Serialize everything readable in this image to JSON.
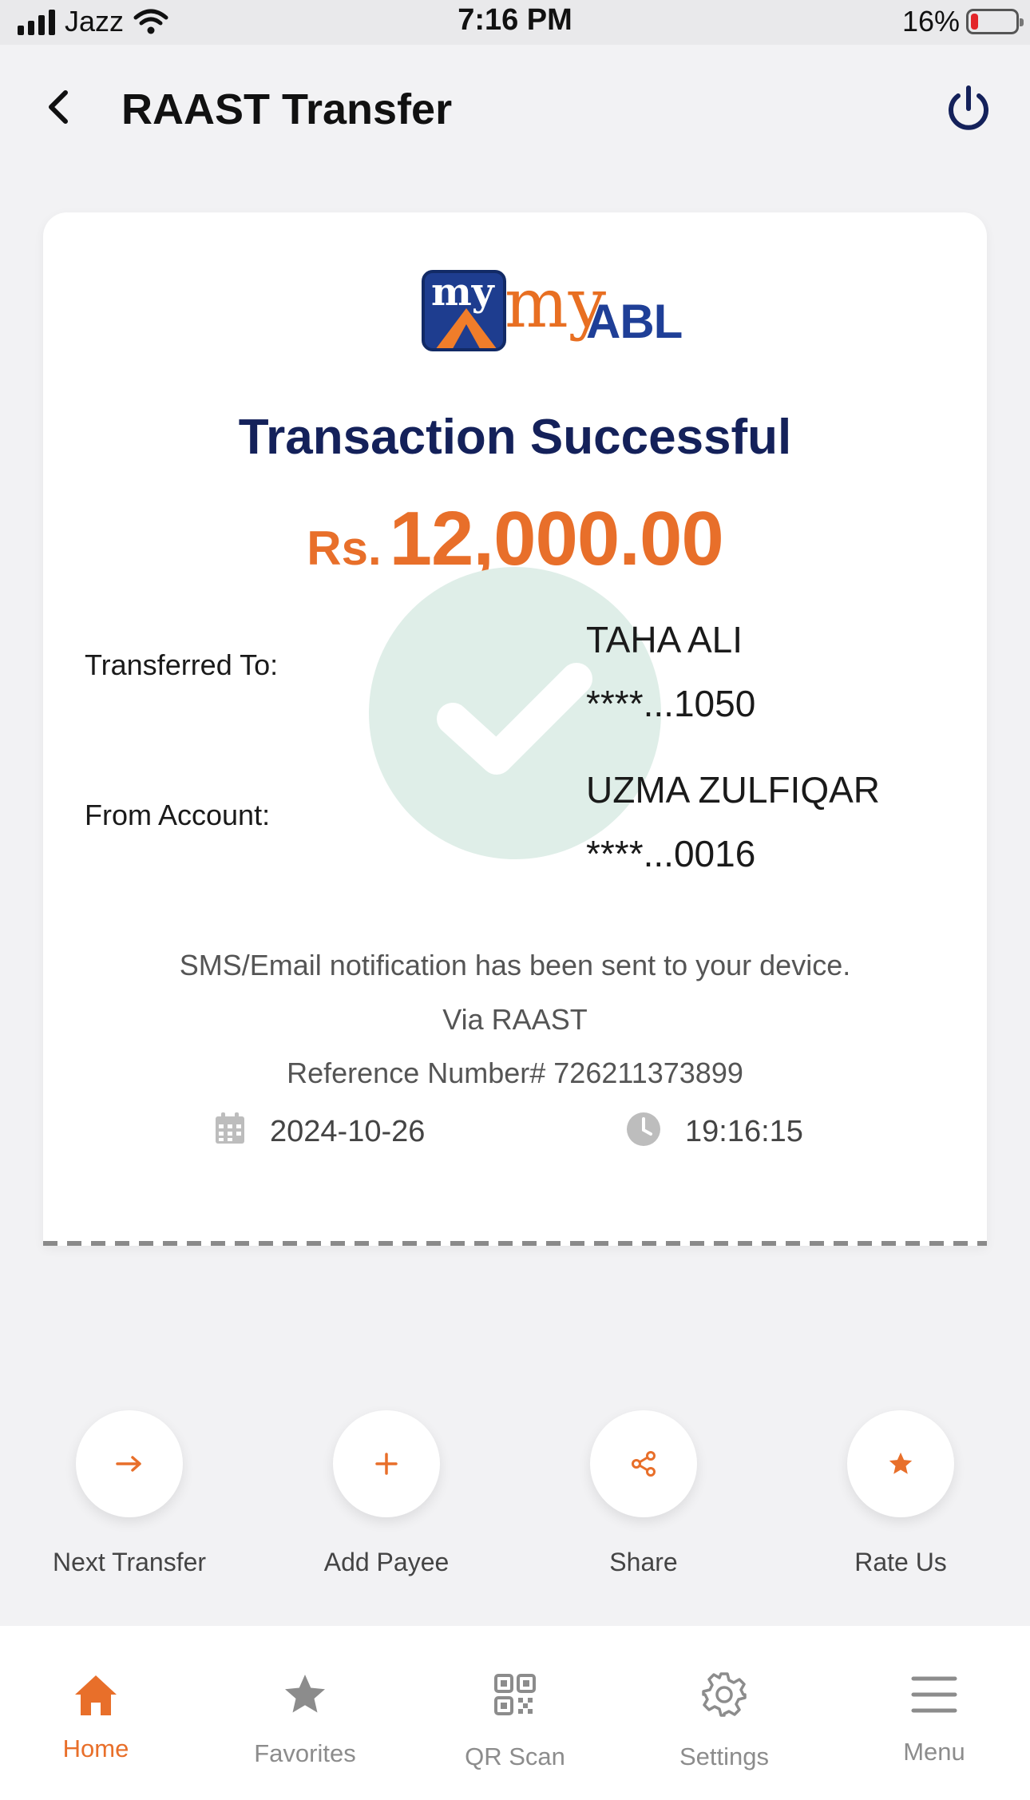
{
  "status_bar": {
    "carrier": "Jazz",
    "time": "7:16 PM",
    "battery": "16%",
    "battery_level": 0.16
  },
  "header": {
    "title": "RAAST Transfer",
    "back_icon": "chevron-left-icon",
    "power_icon": "power-icon"
  },
  "receipt": {
    "logo_my": "my",
    "logo_abl": "ABL",
    "status": "Transaction Successful",
    "currency": "Rs.",
    "amount": "12,000.00",
    "transferred_to_label": "Transferred To:",
    "to_name": "TAHA ALI",
    "to_account": "****...1050",
    "from_account_label": "From Account:",
    "from_name": "UZMA ZULFIQAR",
    "from_account": "****...0016",
    "notification": "SMS/Email notification has been sent to your device.",
    "via": "Via RAAST",
    "reference": "Reference Number# 726211373899",
    "date": "2024-10-26",
    "time": "19:16:15"
  },
  "actions": [
    {
      "label": "Next Transfer",
      "icon": "arrow-right-icon"
    },
    {
      "label": "Add Payee",
      "icon": "plus-icon"
    },
    {
      "label": "Share",
      "icon": "share-icon"
    },
    {
      "label": "Rate Us",
      "icon": "star-icon"
    }
  ],
  "nav": [
    {
      "label": "Home",
      "icon": "home-icon",
      "active": true
    },
    {
      "label": "Favorites",
      "icon": "star-icon",
      "active": false
    },
    {
      "label": "QR Scan",
      "icon": "qr-icon",
      "active": false
    },
    {
      "label": "Settings",
      "icon": "gear-icon",
      "active": false
    },
    {
      "label": "Menu",
      "icon": "menu-icon",
      "active": false
    }
  ],
  "colors": {
    "accent": "#e86f2a",
    "navy": "#14215a",
    "success_circle": "#dfeee8",
    "inactive": "#8c8c8c"
  }
}
